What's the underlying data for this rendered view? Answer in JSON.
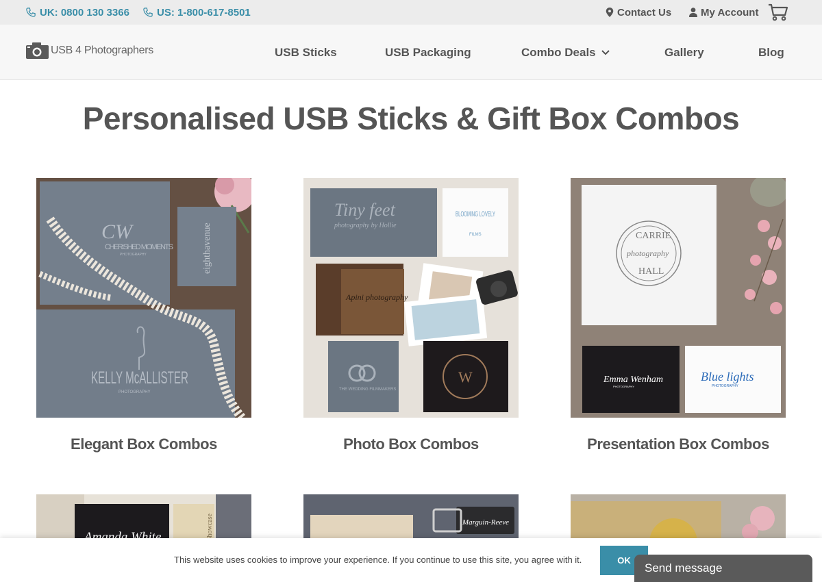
{
  "topbar": {
    "phone_uk": "UK: 0800 130 3366",
    "phone_us": "US: 1-800-617-8501",
    "contact": "Contact Us",
    "account": "My Account",
    "accent_color": "#3a8ea8"
  },
  "header": {
    "logo_text": "USB 4 Photographers",
    "nav": [
      "USB Sticks",
      "USB Packaging",
      "Combo Deals",
      "Gallery",
      "Blog"
    ]
  },
  "main": {
    "title": "Personalised USB Sticks & Gift Box Combos",
    "cards": [
      {
        "label": "Elegant Box Combos",
        "img_texts": [
          "CW",
          "CHERISHED MOMENTS",
          "PHOTOGRAPHY",
          "eighthavenue",
          "KELLY McALLISTER",
          "PHOTOGRAPHY"
        ]
      },
      {
        "label": "Photo Box Combos",
        "img_texts": [
          "Tiny feet",
          "photography by Hollie",
          "BLOOMING LOVELY",
          "FILMS",
          "Apini photography",
          "THE WEDDING FILMMAKERS",
          "W"
        ]
      },
      {
        "label": "Presentation Box Combos",
        "img_texts": [
          "CARRIE",
          "photography",
          "HALL",
          "Emma Wenham",
          "PHOTOGRAPHY",
          "Blue lights",
          "PHOTOGRAPHY"
        ]
      }
    ],
    "row2_texts": [
      "Amanda White",
      "Showcase",
      "Marguin-Reeve"
    ]
  },
  "cookie": {
    "message": "This website uses cookies to improve your experience. If you continue to use this site, you agree with it.",
    "ok_label": "OK"
  },
  "chat": {
    "label": "Send message"
  }
}
